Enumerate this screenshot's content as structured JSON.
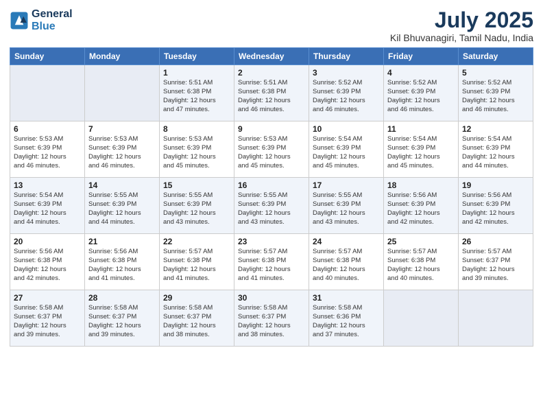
{
  "logo": {
    "line1": "General",
    "line2": "Blue"
  },
  "title": "July 2025",
  "subtitle": "Kil Bhuvanagiri, Tamil Nadu, India",
  "weekdays": [
    "Sunday",
    "Monday",
    "Tuesday",
    "Wednesday",
    "Thursday",
    "Friday",
    "Saturday"
  ],
  "weeks": [
    [
      {
        "day": null
      },
      {
        "day": null
      },
      {
        "day": "1",
        "sunrise": "5:51 AM",
        "sunset": "6:38 PM",
        "daylight": "12 hours and 47 minutes."
      },
      {
        "day": "2",
        "sunrise": "5:51 AM",
        "sunset": "6:38 PM",
        "daylight": "12 hours and 46 minutes."
      },
      {
        "day": "3",
        "sunrise": "5:52 AM",
        "sunset": "6:39 PM",
        "daylight": "12 hours and 46 minutes."
      },
      {
        "day": "4",
        "sunrise": "5:52 AM",
        "sunset": "6:39 PM",
        "daylight": "12 hours and 46 minutes."
      },
      {
        "day": "5",
        "sunrise": "5:52 AM",
        "sunset": "6:39 PM",
        "daylight": "12 hours and 46 minutes."
      }
    ],
    [
      {
        "day": "6",
        "sunrise": "5:53 AM",
        "sunset": "6:39 PM",
        "daylight": "12 hours and 46 minutes."
      },
      {
        "day": "7",
        "sunrise": "5:53 AM",
        "sunset": "6:39 PM",
        "daylight": "12 hours and 46 minutes."
      },
      {
        "day": "8",
        "sunrise": "5:53 AM",
        "sunset": "6:39 PM",
        "daylight": "12 hours and 45 minutes."
      },
      {
        "day": "9",
        "sunrise": "5:53 AM",
        "sunset": "6:39 PM",
        "daylight": "12 hours and 45 minutes."
      },
      {
        "day": "10",
        "sunrise": "5:54 AM",
        "sunset": "6:39 PM",
        "daylight": "12 hours and 45 minutes."
      },
      {
        "day": "11",
        "sunrise": "5:54 AM",
        "sunset": "6:39 PM",
        "daylight": "12 hours and 45 minutes."
      },
      {
        "day": "12",
        "sunrise": "5:54 AM",
        "sunset": "6:39 PM",
        "daylight": "12 hours and 44 minutes."
      }
    ],
    [
      {
        "day": "13",
        "sunrise": "5:54 AM",
        "sunset": "6:39 PM",
        "daylight": "12 hours and 44 minutes."
      },
      {
        "day": "14",
        "sunrise": "5:55 AM",
        "sunset": "6:39 PM",
        "daylight": "12 hours and 44 minutes."
      },
      {
        "day": "15",
        "sunrise": "5:55 AM",
        "sunset": "6:39 PM",
        "daylight": "12 hours and 43 minutes."
      },
      {
        "day": "16",
        "sunrise": "5:55 AM",
        "sunset": "6:39 PM",
        "daylight": "12 hours and 43 minutes."
      },
      {
        "day": "17",
        "sunrise": "5:55 AM",
        "sunset": "6:39 PM",
        "daylight": "12 hours and 43 minutes."
      },
      {
        "day": "18",
        "sunrise": "5:56 AM",
        "sunset": "6:39 PM",
        "daylight": "12 hours and 42 minutes."
      },
      {
        "day": "19",
        "sunrise": "5:56 AM",
        "sunset": "6:39 PM",
        "daylight": "12 hours and 42 minutes."
      }
    ],
    [
      {
        "day": "20",
        "sunrise": "5:56 AM",
        "sunset": "6:38 PM",
        "daylight": "12 hours and 42 minutes."
      },
      {
        "day": "21",
        "sunrise": "5:56 AM",
        "sunset": "6:38 PM",
        "daylight": "12 hours and 41 minutes."
      },
      {
        "day": "22",
        "sunrise": "5:57 AM",
        "sunset": "6:38 PM",
        "daylight": "12 hours and 41 minutes."
      },
      {
        "day": "23",
        "sunrise": "5:57 AM",
        "sunset": "6:38 PM",
        "daylight": "12 hours and 41 minutes."
      },
      {
        "day": "24",
        "sunrise": "5:57 AM",
        "sunset": "6:38 PM",
        "daylight": "12 hours and 40 minutes."
      },
      {
        "day": "25",
        "sunrise": "5:57 AM",
        "sunset": "6:38 PM",
        "daylight": "12 hours and 40 minutes."
      },
      {
        "day": "26",
        "sunrise": "5:57 AM",
        "sunset": "6:37 PM",
        "daylight": "12 hours and 39 minutes."
      }
    ],
    [
      {
        "day": "27",
        "sunrise": "5:58 AM",
        "sunset": "6:37 PM",
        "daylight": "12 hours and 39 minutes."
      },
      {
        "day": "28",
        "sunrise": "5:58 AM",
        "sunset": "6:37 PM",
        "daylight": "12 hours and 39 minutes."
      },
      {
        "day": "29",
        "sunrise": "5:58 AM",
        "sunset": "6:37 PM",
        "daylight": "12 hours and 38 minutes."
      },
      {
        "day": "30",
        "sunrise": "5:58 AM",
        "sunset": "6:37 PM",
        "daylight": "12 hours and 38 minutes."
      },
      {
        "day": "31",
        "sunrise": "5:58 AM",
        "sunset": "6:36 PM",
        "daylight": "12 hours and 37 minutes."
      },
      {
        "day": null
      },
      {
        "day": null
      }
    ]
  ]
}
